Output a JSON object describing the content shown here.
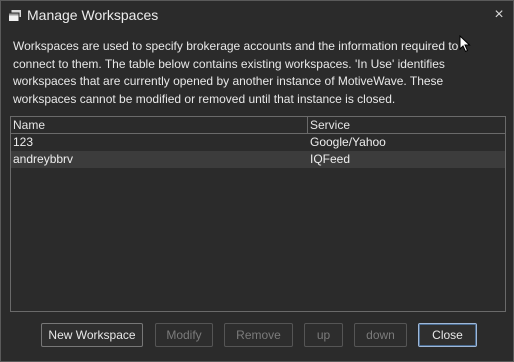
{
  "window": {
    "title": "Manage Workspaces",
    "close_symbol": "×"
  },
  "description": "Workspaces are used to specify brokerage accounts and the information required to connect to them. The table below contains existing workspaces. 'In Use' identifies workspaces that are currently opened by another instance of MotiveWave. These workspaces cannot be modified or removed until that instance is closed.",
  "table": {
    "columns": [
      "Name",
      "Service"
    ],
    "rows": [
      {
        "name": "123",
        "service": "Google/Yahoo",
        "selected": false
      },
      {
        "name": "andreybbrv",
        "service": "IQFeed",
        "selected": true
      }
    ]
  },
  "buttons": {
    "new_workspace": {
      "label": "New Workspace",
      "enabled": true
    },
    "modify": {
      "label": "Modify",
      "enabled": false
    },
    "remove": {
      "label": "Remove",
      "enabled": false
    },
    "up": {
      "label": "up",
      "enabled": false
    },
    "down": {
      "label": "down",
      "enabled": false
    },
    "close": {
      "label": "Close",
      "enabled": true,
      "default": true
    }
  },
  "icons": {
    "title": "workspaces-window-icon",
    "close": "close-icon",
    "cursor": "mouse-cursor-icon"
  },
  "colors": {
    "background": "#2b2b2b",
    "selected_row": "#3c3c3c",
    "text": "#e6e6e6",
    "disabled_text": "#7b7b7b",
    "default_button_border": "#9fb8d8"
  }
}
